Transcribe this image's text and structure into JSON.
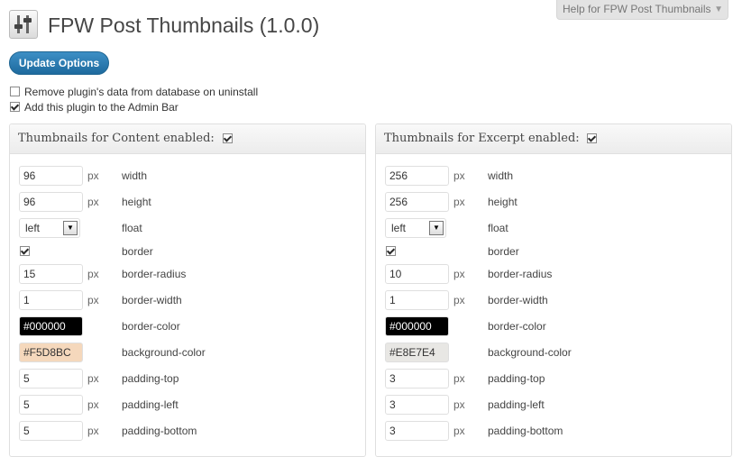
{
  "header": {
    "title": "FPW Post Thumbnails (1.0.0)",
    "help_tab": "Help for FPW Post Thumbnails",
    "help_arrow": "▼",
    "icon": "settings-sliders-icon"
  },
  "update_button": "Update Options",
  "options": [
    {
      "label": "Remove plugin's data from database on uninstall",
      "checked": false
    },
    {
      "label": "Add this plugin to the Admin Bar",
      "checked": true
    }
  ],
  "units": {
    "px": "px"
  },
  "panels": {
    "content": {
      "title": "Thumbnails for Content enabled:",
      "enabled": true,
      "width": "96",
      "height": "96",
      "float": "left",
      "border_checked": true,
      "border_radius": "15",
      "border_width": "1",
      "border_color": "#000000",
      "background_color": "#F5D8BC",
      "padding_top": "5",
      "padding_left": "5",
      "padding_bottom": "5"
    },
    "excerpt": {
      "title": "Thumbnails for Excerpt enabled:",
      "enabled": true,
      "width": "256",
      "height": "256",
      "float": "left",
      "border_checked": true,
      "border_radius": "10",
      "border_width": "1",
      "border_color": "#000000",
      "background_color": "#E8E7E4",
      "padding_top": "3",
      "padding_left": "3",
      "padding_bottom": "3"
    }
  },
  "field_labels": {
    "width": "width",
    "height": "height",
    "float": "float",
    "border": "border",
    "border_radius": "border-radius",
    "border_width": "border-width",
    "border_color": "border-color",
    "background_color": "background-color",
    "padding_top": "padding-top",
    "padding_left": "padding-left",
    "padding_bottom": "padding-bottom"
  },
  "colors": {
    "button": "#2a7ab3",
    "border_color_swatch": "#000000",
    "content_bg_swatch": "#F5D8BC",
    "excerpt_bg_swatch": "#E8E7E4"
  }
}
